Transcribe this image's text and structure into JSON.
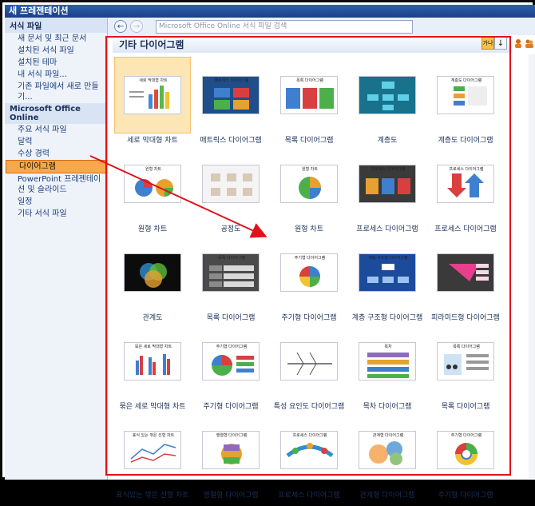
{
  "window_title": "새 프레젠테이션",
  "sidebar": {
    "header1": "서식 파일",
    "items_local": [
      {
        "label": "새 문서 및 최근 문서"
      },
      {
        "label": "설치된 서식 파일"
      },
      {
        "label": "설치된 테마"
      },
      {
        "label": "내 서식 파일..."
      },
      {
        "label": "기존 파일에서 새로 만들기..."
      }
    ],
    "header2": "Microsoft Office Online",
    "items_online": [
      {
        "label": "주요 서식 파일"
      },
      {
        "label": "달력"
      },
      {
        "label": "수상 경력"
      },
      {
        "label": "다이어그램"
      },
      {
        "label": "PowerPoint 프레젠테이션 및 슬라이드"
      },
      {
        "label": "일정"
      },
      {
        "label": "기타 서식 파일"
      }
    ]
  },
  "nav": {
    "back_glyph": "←",
    "forward_glyph": "→",
    "search_placeholder": "Microsoft Office Online 서식 파일 검색"
  },
  "section_title": "기타 다이어그램",
  "toolbar": {
    "view_label": "가나",
    "sort_label": "↓",
    "icon1": "person-icon",
    "icon2": "people-icon"
  },
  "templates": [
    {
      "label": "세로 막대형 차트",
      "thumb_text": "세로 막대형 차트",
      "style": "bar",
      "selected": true
    },
    {
      "label": "매트릭스 다이어그램",
      "thumb_text": "매트릭스 다이어그램",
      "style": "matrix"
    },
    {
      "label": "목록 다이어그램",
      "thumb_text": "목록 다이어그램",
      "style": "list3d"
    },
    {
      "label": "계층도",
      "thumb_text": "",
      "style": "hier"
    },
    {
      "label": "계층도 다이어그램",
      "thumb_text": "계층도 다이어그램",
      "style": "hier2"
    },
    {
      "label": "원형 차트",
      "thumb_text": "원형 차트",
      "style": "pie"
    },
    {
      "label": "공정도",
      "thumb_text": "",
      "style": "flow"
    },
    {
      "label": "원형 차트",
      "thumb_text": "원형 차트",
      "style": "pie2"
    },
    {
      "label": "프로세스 다이어그램",
      "thumb_text": "프로세스 다이어그램",
      "style": "process"
    },
    {
      "label": "프로세스 다이어그램",
      "thumb_text": "프로세스 다이어그램",
      "style": "process2"
    },
    {
      "label": "관계도",
      "thumb_text": "",
      "style": "venn"
    },
    {
      "label": "목록 다이어그램",
      "thumb_text": "목록 다이어그램",
      "style": "listdark"
    },
    {
      "label": "주기형 다이어그램",
      "thumb_text": "주기형 다이어그램",
      "style": "cycle"
    },
    {
      "label": "계층 구조형 다이어그램",
      "thumb_text": "계층 구조형 다이어그램",
      "style": "hierblue"
    },
    {
      "label": "피라미드형 다이어그램",
      "thumb_text": "",
      "style": "pyramid"
    },
    {
      "label": "묶은 세로 막대형 차트",
      "thumb_text": "묶은 세로 막대형 차트",
      "style": "bar2"
    },
    {
      "label": "주기형 다이어그램",
      "thumb_text": "주기형 다이어그램",
      "style": "cycle2"
    },
    {
      "label": "특성 요인도 다이어그램",
      "thumb_text": "",
      "style": "fishbone"
    },
    {
      "label": "목차 다이어그램",
      "thumb_text": "목차",
      "style": "toc"
    },
    {
      "label": "목록 다이어그램",
      "thumb_text": "목록 다이어그램",
      "style": "people"
    },
    {
      "label": "표식있는 꺾은 선형 차트",
      "thumb_text": "표식 있는 꺾은 선형 차트",
      "style": "line"
    },
    {
      "label": "행렬형 다이어그램",
      "thumb_text": "행렬형 다이어그램",
      "style": "matrix2"
    },
    {
      "label": "프로세스 다이어그램",
      "thumb_text": "프로세스 다이어그램",
      "style": "process3"
    },
    {
      "label": "관계형 다이어그램",
      "thumb_text": "관계형 다이어그램",
      "style": "rel"
    },
    {
      "label": "주기형 다이어그램",
      "thumb_text": "주기형 다이어그램",
      "style": "cycle3"
    }
  ]
}
